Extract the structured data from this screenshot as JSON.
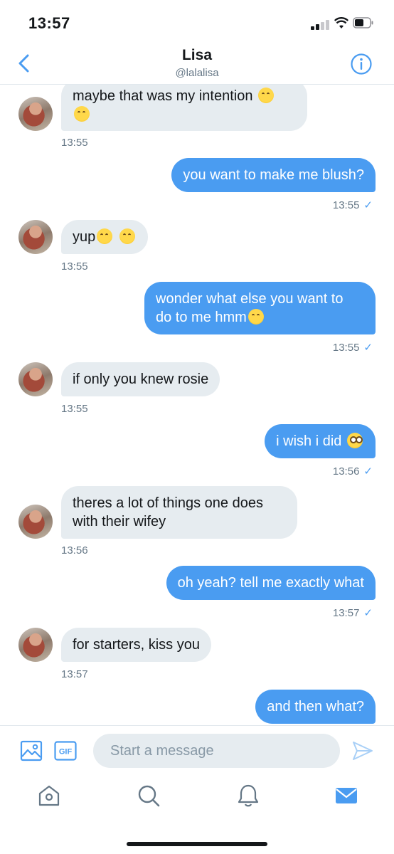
{
  "status_bar": {
    "time": "13:57"
  },
  "header": {
    "name": "Lisa",
    "handle": "@lalalisa"
  },
  "messages": [
    {
      "dir": "in",
      "text": "maybe that was my intention",
      "time": "13:55"
    },
    {
      "dir": "out",
      "text": "you want to make me blush?",
      "time": "13:55"
    },
    {
      "dir": "in",
      "text": "yup",
      "time": "13:55"
    },
    {
      "dir": "out",
      "text": "wonder what else you want to",
      "text2": "do to me hmm",
      "time": "13:55"
    },
    {
      "dir": "in",
      "text": "if only you knew rosie",
      "time": "13:55"
    },
    {
      "dir": "out",
      "text": "i wish i did",
      "time": "13:56"
    },
    {
      "dir": "in",
      "text": "theres a lot of things one does",
      "text2": "with their wifey",
      "time": "13:56"
    },
    {
      "dir": "out",
      "text": "oh yeah? tell me exactly what",
      "time": "13:57"
    },
    {
      "dir": "in",
      "text": "for starters, kiss you",
      "time": "13:57"
    },
    {
      "dir": "out",
      "text": "and then what?"
    }
  ],
  "composer": {
    "placeholder": "Start a message",
    "gif_label": "GIF"
  },
  "icons": {
    "back": "chevron-left-icon",
    "info": "info-icon",
    "image": "image-icon",
    "gif": "gif-icon",
    "send": "send-icon",
    "home": "home-icon",
    "search": "search-icon",
    "notifications": "bell-icon",
    "messages": "mail-icon",
    "emoji_kiss": "kissing-face-icon",
    "emoji_yum": "yum-face-icon",
    "emoji_flushed": "flushed-face-icon"
  },
  "colors": {
    "accent": "#4a9cf1",
    "incoming_bubble": "#e6ecf0",
    "muted_text": "#657786"
  }
}
